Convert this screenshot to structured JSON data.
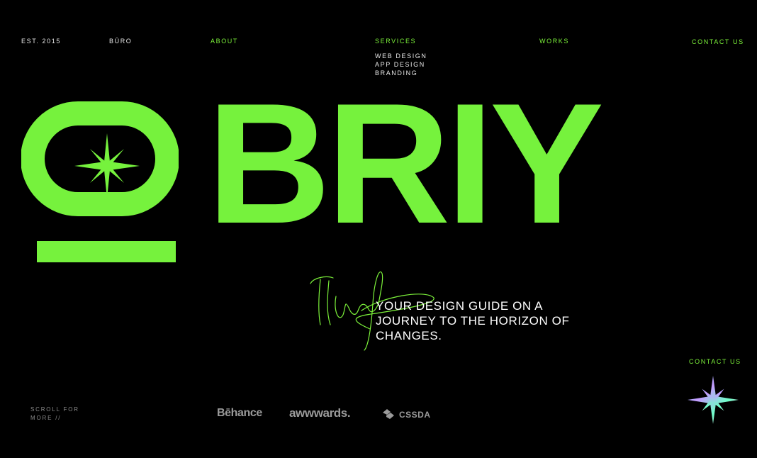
{
  "header": {
    "est": "EST. 2015",
    "buro": "BŪRO",
    "about": "ABOUT",
    "services": "SERVICES",
    "works": "WORKS",
    "contact": "CONTACT US"
  },
  "services_menu": [
    "WEB DESIGN",
    "APP DESIGN",
    "BRANDING"
  ],
  "brand": {
    "name": "OBRIY",
    "letters_after_o": "BRIY"
  },
  "tagline": "YOUR DESIGN GUIDE ON A JOURNEY TO THE HORIZON OF CHANGES.",
  "footer": {
    "scroll_line1": "SCROLL FOR",
    "scroll_line2": "MORE //",
    "badges": [
      "Bēhance",
      "awwwards.",
      "CSSDA"
    ],
    "contact": "CONTACT US"
  },
  "colors": {
    "accent": "#76f23d",
    "background": "#000000",
    "text": "#ffffff"
  }
}
